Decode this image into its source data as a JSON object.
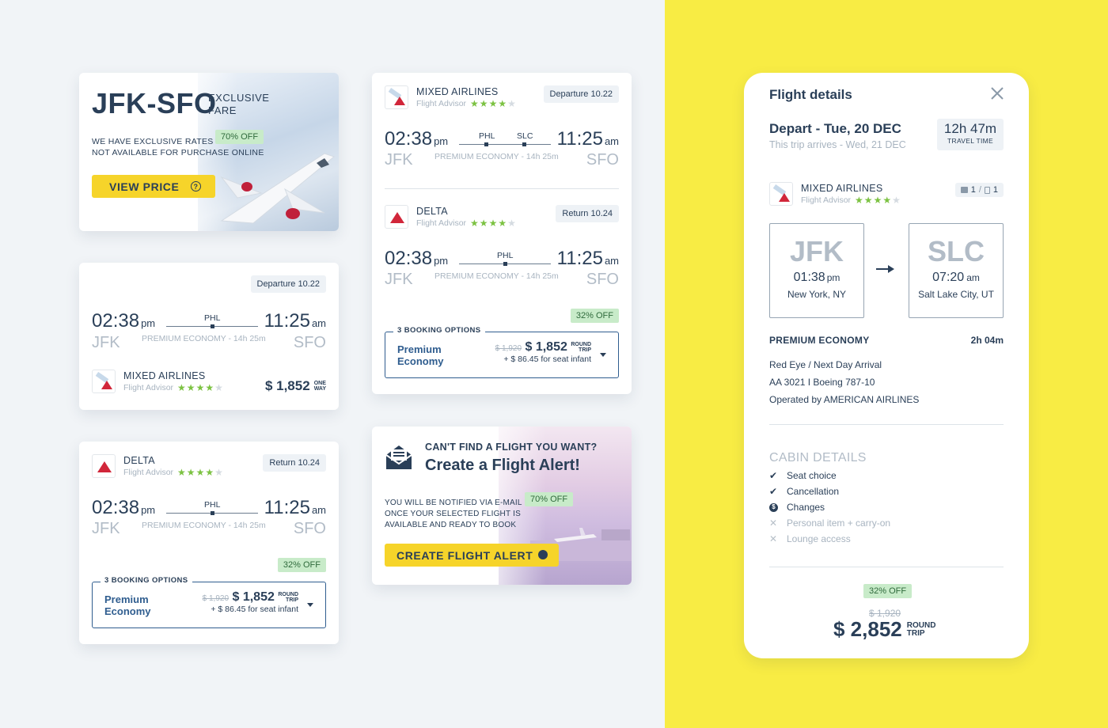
{
  "promo": {
    "route": "JFK-SFO",
    "label_line1": "EXCLUSIVE",
    "label_line2": "FARE",
    "discount": "70% OFF",
    "text_line1": "WE HAVE EXCLUSIVE RATES",
    "text_line2": "NOT AVAILABLE  FOR PURCHASE ONLINE",
    "button": "VIEW PRICE",
    "button_icon": "question-icon"
  },
  "card_one_way": {
    "departure_pill": "Departure 10.22",
    "dep_time": "02:38",
    "dep_ampm": "pm",
    "dep_code": "JFK",
    "stop": "PHL",
    "info": "PREMIUM ECONOMY - 14h 25m",
    "arr_time": "11:25",
    "arr_ampm": "am",
    "arr_code": "SFO",
    "airline": "MIXED AIRLINES",
    "advisor": "Flight Advisor",
    "rating": 4,
    "price": "$ 1,852",
    "price_note1": "ONE",
    "price_note2": "WAY"
  },
  "card_return": {
    "airline": "DELTA",
    "advisor": "Flight Advisor",
    "rating": 4,
    "return_pill": "Return 10.24",
    "dep_time": "02:38",
    "dep_ampm": "pm",
    "dep_code": "JFK",
    "stop": "PHL",
    "info": "PREMIUM ECONOMY - 14h 25m",
    "arr_time": "11:25",
    "arr_ampm": "am",
    "arr_code": "SFO",
    "discount": "32% OFF",
    "booking_legend": "3 BOOKING OPTIONS",
    "class_line1": "Premium",
    "class_line2": "Economy",
    "old_price": "$ 1,920",
    "price": "$ 1,852",
    "price_note1": "ROUND",
    "price_note2": "TRIP",
    "infant": "+ $ 86.45 for seat infant"
  },
  "card_round": {
    "out": {
      "airline": "MIXED AIRLINES",
      "advisor": "Flight Advisor",
      "rating": 4,
      "pill": "Departure 10.22",
      "dep_time": "02:38",
      "dep_ampm": "pm",
      "dep_code": "JFK",
      "stop1": "PHL",
      "stop2": "SLC",
      "info": "PREMIUM ECONOMY - 14h 25m",
      "arr_time": "11:25",
      "arr_ampm": "am",
      "arr_code": "SFO"
    },
    "back": {
      "airline": "DELTA",
      "advisor": "Flight Advisor",
      "rating": 4,
      "pill": "Return 10.24",
      "dep_time": "02:38",
      "dep_ampm": "pm",
      "dep_code": "JFK",
      "stop": "PHL",
      "info": "PREMIUM ECONOMY - 14h 25m",
      "arr_time": "11:25",
      "arr_ampm": "am",
      "arr_code": "SFO"
    },
    "discount": "32% OFF",
    "booking_legend": "3 BOOKING OPTIONS",
    "class_line1": "Premium",
    "class_line2": "Economy",
    "old_price": "$ 1,920",
    "price": "$ 1,852",
    "price_note1": "ROUND",
    "price_note2": "TRIP",
    "infant": "+ $ 86.45 for seat infant"
  },
  "alert": {
    "kicker": "CAN'T FIND A FLIGHT YOU WANT?",
    "title": "Create a Flight Alert!",
    "text_line1": "YOU WILL BE NOTIFIED VIA E-MAIL",
    "text_line2": "ONCE YOUR SELECTED FLIGHT IS",
    "text_line3": "AVAILABLE AND READY TO BOOK",
    "discount": "70% OFF",
    "button": "CREATE FLIGHT ALERT",
    "icon": "mail-icon"
  },
  "details": {
    "title": "Flight details",
    "depart": "Depart - Tue, 20 DEC",
    "arrives": "This trip arrives - Wed, 21 DEC",
    "travel_time": "12h 47m",
    "travel_time_label": "TRAVEL TIME",
    "airline": "MIXED AIRLINES",
    "advisor": "Flight Advisor",
    "rating": 4,
    "bags_carry": "1",
    "bags_checked": "1",
    "from_code": "JFK",
    "from_time": "01:38",
    "from_ampm": "pm",
    "from_city": "New York, NY",
    "to_code": "SLC",
    "to_time": "07:20",
    "to_ampm": "am",
    "to_city": "Salt Lake City, UT",
    "class": "PREMIUM ECONOMY",
    "duration": "2h 04m",
    "info1": "Red Eye / Next Day Arrival",
    "info2": "AA 3021 I Boeing 787-10",
    "info3": "Operated by AMERICAN AIRLINES",
    "cabin_title": "CABIN DETAILS",
    "cabin": [
      {
        "label": "Seat choice",
        "status": "included"
      },
      {
        "label": "Cancellation",
        "status": "included"
      },
      {
        "label": "Changes",
        "status": "fee"
      },
      {
        "label": "Personal item + carry-on",
        "status": "excluded"
      },
      {
        "label": "Lounge access",
        "status": "excluded"
      }
    ],
    "discount": "32% OFF",
    "old_price": "$ 1,920",
    "price": "$ 2,852",
    "price_note1": "ROUND",
    "price_note2": "TRIP"
  },
  "colors": {
    "navy": "#2a3f58",
    "accent_yellow": "#f6d42a",
    "background_yellow": "#f8ec44",
    "discount_green": "#c8ebc9",
    "star_green": "#7cc242",
    "delta_red": "#d1263a"
  }
}
